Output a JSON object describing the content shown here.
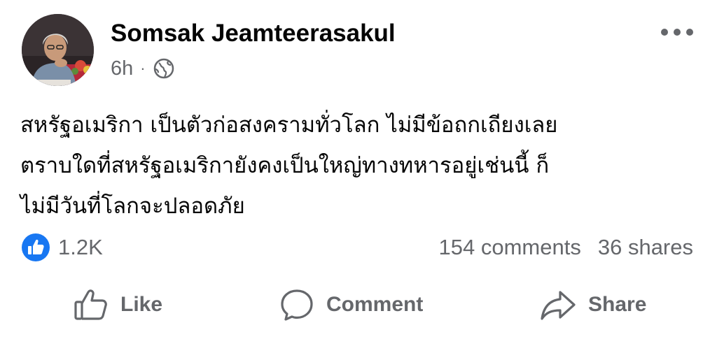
{
  "post": {
    "author": "Somsak Jeamteerasakul",
    "time": "6h",
    "separator": "·",
    "privacy_icon": "globe-icon",
    "more_icon": "ellipsis-icon",
    "text_lines": [
      "สหรัฐอเมริกา เป็นตัวก่อสงครามทั่วโลก ไม่มีข้อถกเถียงเลย",
      "ตราบใดที่สหรัฐอเมริกายังคงเป็นใหญ่ทางทหารอยู่เช่นนี้ ก็",
      "ไม่มีวันที่โลกจะปลอดภัย"
    ]
  },
  "stats": {
    "reaction_icon": "like-reaction-icon",
    "reactions": "1.2K",
    "comments": "154 comments",
    "shares": "36 shares"
  },
  "actions": {
    "like": "Like",
    "comment": "Comment",
    "share": "Share"
  },
  "colors": {
    "text": "#050505",
    "secondary": "#65676b",
    "like_blue": "#1877f2"
  }
}
